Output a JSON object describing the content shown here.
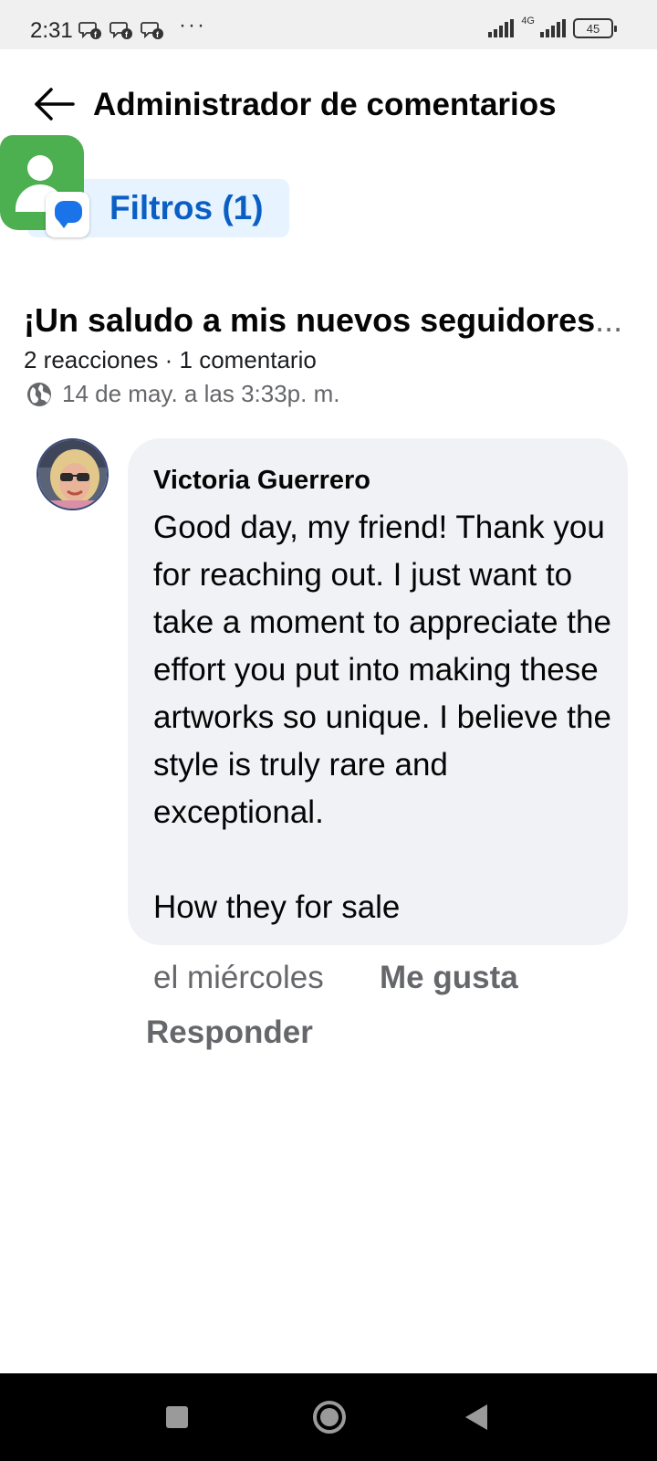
{
  "status_bar": {
    "time": "2:31",
    "dots": "···",
    "network": "4G",
    "battery": "45"
  },
  "header": {
    "title": "Administrador de comentarios"
  },
  "filter": {
    "label": "Filtros (1)"
  },
  "post": {
    "title": "¡Un saludo a mis nuevos seguidores",
    "title_ellipsis": "...",
    "stats": "2 reacciones · 1 comentario",
    "date": "14 de may. a las 3:33p. m."
  },
  "comment": {
    "author": "Victoria Guerrero",
    "text": "Good day, my friend! Thank you for reaching out. I just want to take a moment to appreciate the effort you put into making these artworks so unique. I believe the style is truly rare and exceptional.\n\nHow they for sale",
    "time": "el miércoles",
    "like_label": "Me gusta",
    "reply_label": "Responder"
  },
  "colors": {
    "accent": "#0a5fc4",
    "chip_bg": "#e7f3ff",
    "bubble_bg": "#f0f2f5",
    "secondary_text": "#65676b"
  },
  "icons": [
    "back-arrow-icon",
    "contact-icon",
    "message-icon",
    "globe-icon",
    "messenger-facebook-icon"
  ]
}
